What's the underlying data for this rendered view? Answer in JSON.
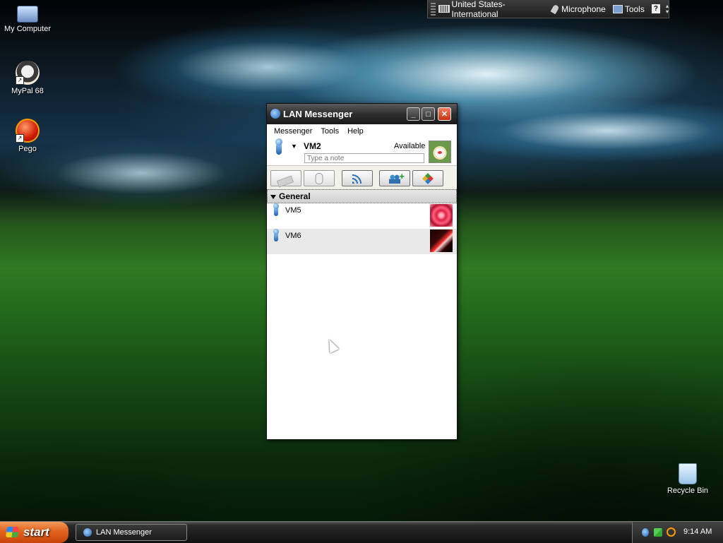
{
  "desktop": {
    "icons": [
      {
        "label": "My Computer",
        "icon": "my-computer-icon"
      },
      {
        "label": "MyPal 68",
        "icon": "mypal-icon"
      },
      {
        "label": "Pego",
        "icon": "pego-icon"
      },
      {
        "label": "Recycle Bin",
        "icon": "recycle-bin-icon"
      }
    ]
  },
  "langbar": {
    "language": "United States-International",
    "microphone": "Microphone",
    "tools": "Tools",
    "help": "?"
  },
  "window": {
    "title": "LAN Messenger",
    "menu": [
      "Messenger",
      "Tools",
      "Help"
    ],
    "profile": {
      "name": "VM2",
      "status": "Available",
      "note_placeholder": "Type a note"
    },
    "group": {
      "name": "General",
      "contacts": [
        {
          "name": "VM5"
        },
        {
          "name": "VM6"
        }
      ]
    }
  },
  "taskbar": {
    "start_label": "start",
    "tasks": [
      {
        "label": "LAN Messenger"
      }
    ],
    "clock": "9:14 AM"
  },
  "colors": {
    "start": "#e2621e",
    "close_button": "#c83010",
    "status_icon": "#1f5fae"
  }
}
